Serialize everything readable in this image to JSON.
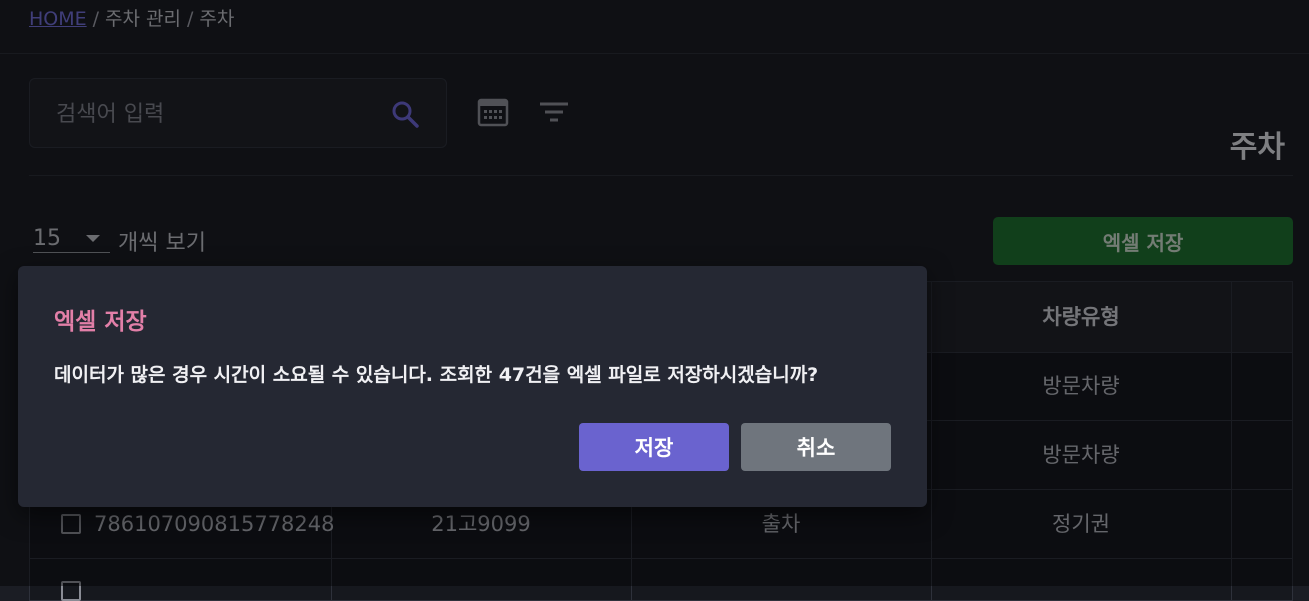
{
  "breadcrumb": {
    "home": "HOME",
    "sep": "/",
    "parent": "주차 관리",
    "current": "주차"
  },
  "search": {
    "placeholder": "검색어 입력",
    "value": ""
  },
  "icons": {
    "search": "search-icon",
    "calendar": "calendar-icon",
    "filter": "filter-icon"
  },
  "page_title": "주차",
  "page_size": {
    "value": "15",
    "label": "개씩 보기"
  },
  "excel_button": "엑셀 저장",
  "table": {
    "headers": [
      "",
      "",
      "",
      "차량유형"
    ],
    "rows": [
      [
        "",
        "",
        "",
        "방문차량"
      ],
      [
        "",
        "",
        "",
        "방문차량"
      ],
      [
        "786107090815778248",
        "21고9099",
        "출차",
        "정기권"
      ],
      [
        "",
        "",
        "",
        ""
      ]
    ]
  },
  "modal": {
    "title": "엑셀 저장",
    "message": "데이터가 많은 경우 시간이 소요될 수 있습니다. 조회한 47건을 엑셀 파일로 저장하시겠습니까?",
    "confirm_label": "저장",
    "cancel_label": "취소"
  },
  "colors": {
    "accent": "#6a63cf",
    "excel_green": "#1e6d2f",
    "modal_title": "#e27fa8",
    "cancel_gray": "#6f757d"
  }
}
